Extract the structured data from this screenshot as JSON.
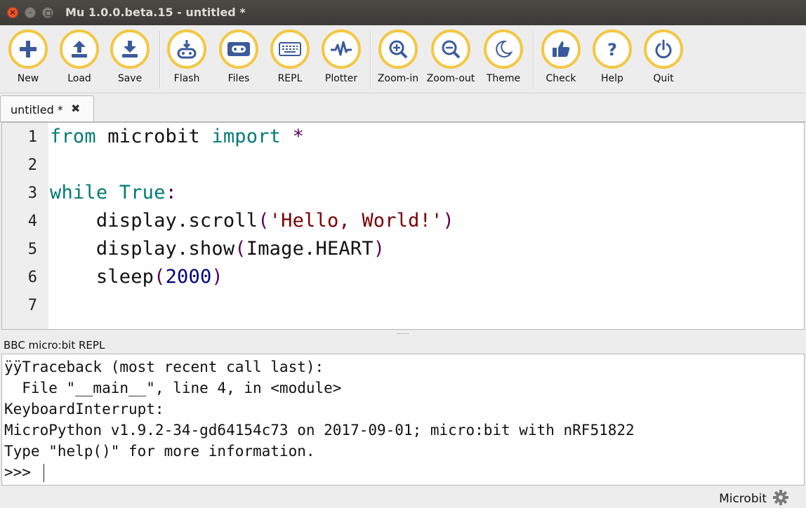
{
  "window": {
    "title": "Mu 1.0.0.beta.15 - untitled *"
  },
  "toolbar": {
    "buttons": [
      {
        "label": "New",
        "icon": "plus-icon"
      },
      {
        "label": "Load",
        "icon": "upload-icon"
      },
      {
        "label": "Save",
        "icon": "download-icon"
      },
      {
        "label": "Flash",
        "icon": "flash-device-icon"
      },
      {
        "label": "Files",
        "icon": "microbit-icon"
      },
      {
        "label": "REPL",
        "icon": "keyboard-icon"
      },
      {
        "label": "Plotter",
        "icon": "pulse-icon"
      },
      {
        "label": "Zoom-in",
        "icon": "zoom-in-icon"
      },
      {
        "label": "Zoom-out",
        "icon": "zoom-out-icon"
      },
      {
        "label": "Theme",
        "icon": "moon-icon"
      },
      {
        "label": "Check",
        "icon": "thumbs-up-icon"
      },
      {
        "label": "Help",
        "icon": "question-icon"
      },
      {
        "label": "Quit",
        "icon": "power-icon"
      }
    ],
    "accent_color": "#f4c742",
    "icon_color": "#3a5a9c"
  },
  "tabs": [
    {
      "label": "untitled *",
      "close": "✖"
    }
  ],
  "editor": {
    "line_numbers": [
      "1",
      "2",
      "3",
      "4",
      "5",
      "6",
      "7"
    ],
    "lines": [
      [
        {
          "t": "from",
          "c": "kw"
        },
        {
          "t": " microbit ",
          "c": ""
        },
        {
          "t": "import",
          "c": "kw"
        },
        {
          "t": " *",
          "c": "punc"
        }
      ],
      [],
      [
        {
          "t": "while",
          "c": "kw"
        },
        {
          "t": " ",
          "c": ""
        },
        {
          "t": "True",
          "c": "kw"
        },
        {
          "t": ":",
          "c": "punc"
        }
      ],
      [
        {
          "t": "    display.scroll",
          "c": ""
        },
        {
          "t": "(",
          "c": "punc"
        },
        {
          "t": "'Hello, World!'",
          "c": "str"
        },
        {
          "t": ")",
          "c": "punc"
        }
      ],
      [
        {
          "t": "    display.show",
          "c": ""
        },
        {
          "t": "(",
          "c": "punc"
        },
        {
          "t": "Image.HEART",
          "c": ""
        },
        {
          "t": ")",
          "c": "punc"
        }
      ],
      [
        {
          "t": "    sleep",
          "c": ""
        },
        {
          "t": "(",
          "c": "punc"
        },
        {
          "t": "2000",
          "c": "num"
        },
        {
          "t": ")",
          "c": "punc"
        }
      ],
      []
    ]
  },
  "repl": {
    "title": "BBC micro:bit REPL",
    "lines": [
      "ÿÿTraceback (most recent call last):",
      "  File \"__main__\", line 4, in <module>",
      "KeyboardInterrupt:",
      "MicroPython v1.9.2-34-gd64154c73 on 2017-09-01; micro:bit with nRF51822",
      "Type \"help()\" for more information.",
      ">>> "
    ]
  },
  "status": {
    "mode": "Microbit",
    "icon": "gear-icon"
  }
}
